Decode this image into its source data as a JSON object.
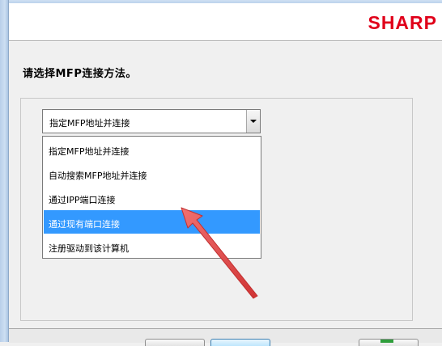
{
  "header": {
    "brand": "SHARP"
  },
  "prompt": "请选择MFP连接方法。",
  "combo": {
    "selected": "指定MFP地址并连接"
  },
  "dropdown": {
    "options": [
      {
        "label": "指定MFP地址并连接"
      },
      {
        "label": "自动搜索MFP地址并连接"
      },
      {
        "label": "通过IPP端口连接"
      },
      {
        "label": "通过现有端口连接",
        "highlighted": true
      },
      {
        "label": "注册驱动到该计算机"
      }
    ]
  },
  "colors": {
    "brand": "#e0001a",
    "highlight": "#3399ff",
    "annotation_arrow": "#e04a4a"
  },
  "icons": {
    "combo_arrow": "chevron-down-icon",
    "annotation": "annotation-arrow-icon"
  }
}
